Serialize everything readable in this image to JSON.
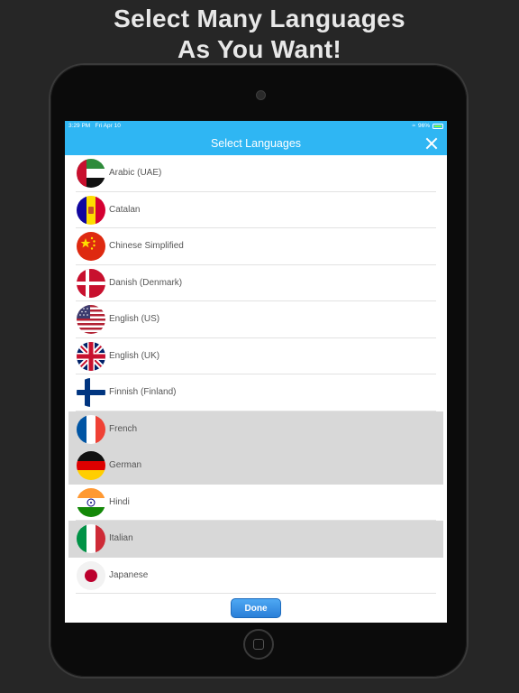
{
  "headline": {
    "line1": "Select Many Languages",
    "line2": "As You Want!"
  },
  "status": {
    "time": "3:29 PM",
    "date": "Fri Apr 10",
    "battery": "96%"
  },
  "nav": {
    "title": "Select Languages",
    "close_icon": "close-icon"
  },
  "languages": [
    {
      "label": "Arabic (UAE)",
      "flag": "uae-flag-icon",
      "selected": false
    },
    {
      "label": "Catalan",
      "flag": "andorra-flag-icon",
      "selected": false
    },
    {
      "label": "Chinese Simplified",
      "flag": "china-flag-icon",
      "selected": false
    },
    {
      "label": "Danish (Denmark)",
      "flag": "denmark-flag-icon",
      "selected": false
    },
    {
      "label": "English (US)",
      "flag": "usa-flag-icon",
      "selected": false
    },
    {
      "label": "English (UK)",
      "flag": "uk-flag-icon",
      "selected": false
    },
    {
      "label": "Finnish (Finland)",
      "flag": "finland-flag-icon",
      "selected": false
    },
    {
      "label": "French",
      "flag": "france-flag-icon",
      "selected": true
    },
    {
      "label": "German",
      "flag": "germany-flag-icon",
      "selected": true
    },
    {
      "label": "Hindi",
      "flag": "india-flag-icon",
      "selected": false
    },
    {
      "label": "Italian",
      "flag": "italy-flag-icon",
      "selected": true
    },
    {
      "label": "Japanese",
      "flag": "japan-flag-icon",
      "selected": false
    }
  ],
  "done_label": "Done",
  "colors": {
    "accent": "#2fb6f3",
    "selected_row": "#d8d8d8",
    "done_button": "#3a93e6"
  }
}
